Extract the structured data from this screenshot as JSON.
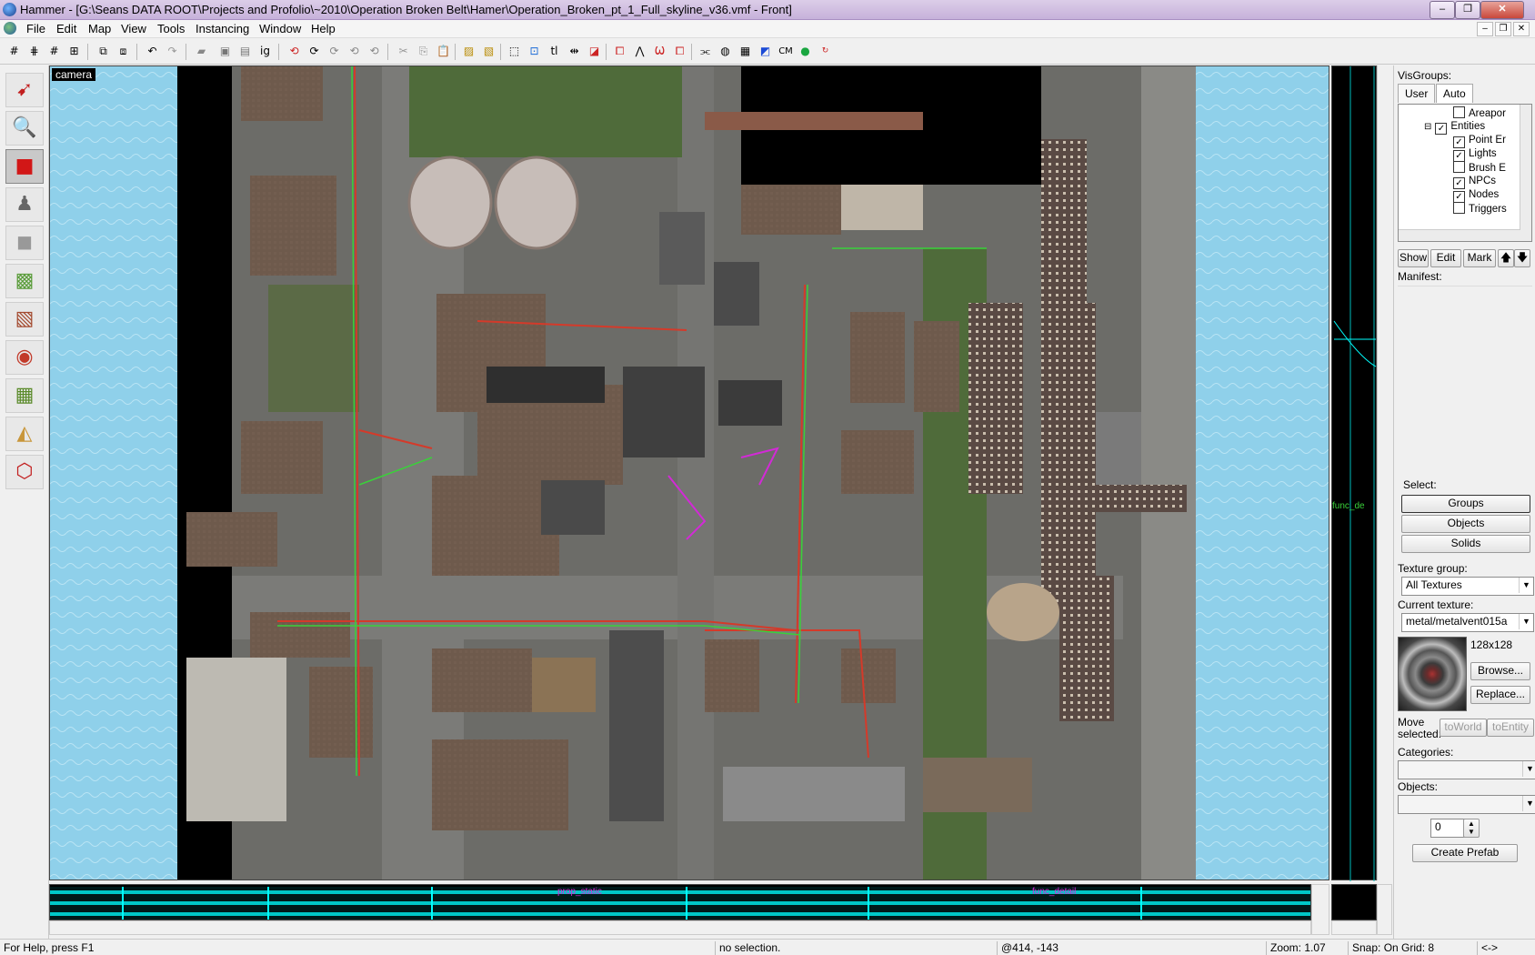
{
  "window": {
    "title": "Hammer - [G:\\Seans DATA ROOT\\Projects and Profolio\\~2010\\Operation Broken Belt\\Hamer\\Operation_Broken_pt_1_Full_skyline_v36.vmf - Front]",
    "minimize": "–",
    "maximize": "❐",
    "close": "✕"
  },
  "menu": {
    "items": [
      "File",
      "Edit",
      "Map",
      "View",
      "Tools",
      "Instancing",
      "Window",
      "Help"
    ],
    "mdi_minimize": "–",
    "mdi_restore": "❐",
    "mdi_close": "✕"
  },
  "viewport": {
    "label": "camera"
  },
  "bottom_view": {
    "fragment_labels": [
      "prop_static",
      "func_detail"
    ]
  },
  "right_view": {
    "fragment_label": "func_de"
  },
  "visgroups": {
    "heading": "VisGroups:",
    "tabs": [
      "User",
      "Auto"
    ],
    "tree": [
      {
        "label": "Areapor",
        "checked": false,
        "indent": 3
      },
      {
        "label": "Entities",
        "checked": true,
        "indent": 2,
        "expander": "⊟"
      },
      {
        "label": "Point Er",
        "checked": true,
        "indent": 3
      },
      {
        "label": "Lights",
        "checked": true,
        "indent": 3
      },
      {
        "label": "Brush E",
        "checked": false,
        "indent": 3
      },
      {
        "label": "NPCs",
        "checked": true,
        "indent": 3
      },
      {
        "label": "Nodes",
        "checked": true,
        "indent": 3
      },
      {
        "label": "Triggers",
        "checked": false,
        "indent": 3
      }
    ],
    "buttons": {
      "show": "Show",
      "edit": "Edit",
      "mark": "Mark",
      "up": "🡅",
      "down": "🡇"
    },
    "manifest": "Manifest:"
  },
  "select": {
    "heading": "Select:",
    "groups": "Groups",
    "objects": "Objects",
    "solids": "Solids"
  },
  "texture": {
    "group_label": "Texture group:",
    "group_value": "All Textures",
    "current_label": "Current texture:",
    "current_value": "metal/metalvent015a",
    "size": "128x128",
    "browse": "Browse...",
    "replace": "Replace..."
  },
  "move": {
    "label": "Move selected:",
    "to_world": "toWorld",
    "to_entity": "toEntity"
  },
  "categories": {
    "label": "Categories:",
    "value": ""
  },
  "objects": {
    "label": "Objects:",
    "value": "",
    "spin_value": "0",
    "create_prefab": "Create Prefab"
  },
  "status": {
    "help": "For Help, press F1",
    "selection": "no selection.",
    "coords": "@414, -143",
    "zoom": "Zoom: 1.07",
    "snap": "Snap: On Grid: 8",
    "extra": "<->"
  },
  "colors": {
    "sky": "#8fd0ea",
    "ground": "#6c6c68",
    "grass": "#4f6b3a",
    "roof_brown": "#6e5a4c",
    "wireframe_cyan": "#00ffff",
    "path_red": "#d43a2a",
    "path_green": "#3ad13a"
  }
}
